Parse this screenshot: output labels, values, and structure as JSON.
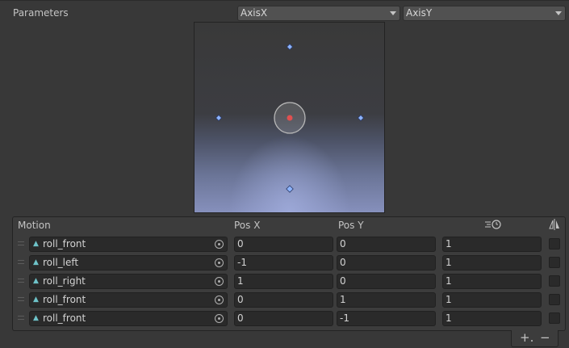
{
  "parameters": {
    "label": "Parameters",
    "x_param": "AxisX",
    "y_param": "AxisY"
  },
  "blend_space": {
    "points": [
      {
        "x": 0,
        "y": 1
      },
      {
        "x": -1,
        "y": 0
      },
      {
        "x": 1,
        "y": 0
      },
      {
        "x": 0,
        "y": -1
      }
    ],
    "current_sample": {
      "x": 0,
      "y": 0
    },
    "colors": {
      "point": "#8db4ff",
      "current": "#e05050"
    }
  },
  "motion_list": {
    "headers": {
      "motion": "Motion",
      "pos_x": "Pos X",
      "pos_y": "Pos Y",
      "speed_icon": "speed-clock-icon",
      "mirror_icon": "mirror-icon"
    },
    "rows": [
      {
        "clip": "roll_front",
        "pos_x": "0",
        "pos_y": "0",
        "speed": "1"
      },
      {
        "clip": "roll_left",
        "pos_x": "-1",
        "pos_y": "0",
        "speed": "1"
      },
      {
        "clip": "roll_right",
        "pos_x": "1",
        "pos_y": "0",
        "speed": "1"
      },
      {
        "clip": "roll_front",
        "pos_x": "0",
        "pos_y": "1",
        "speed": "1"
      },
      {
        "clip": "roll_front",
        "pos_x": "0",
        "pos_y": "-1",
        "speed": "1"
      }
    ]
  },
  "footer": {
    "add_label": "+.",
    "remove_label": "−"
  }
}
